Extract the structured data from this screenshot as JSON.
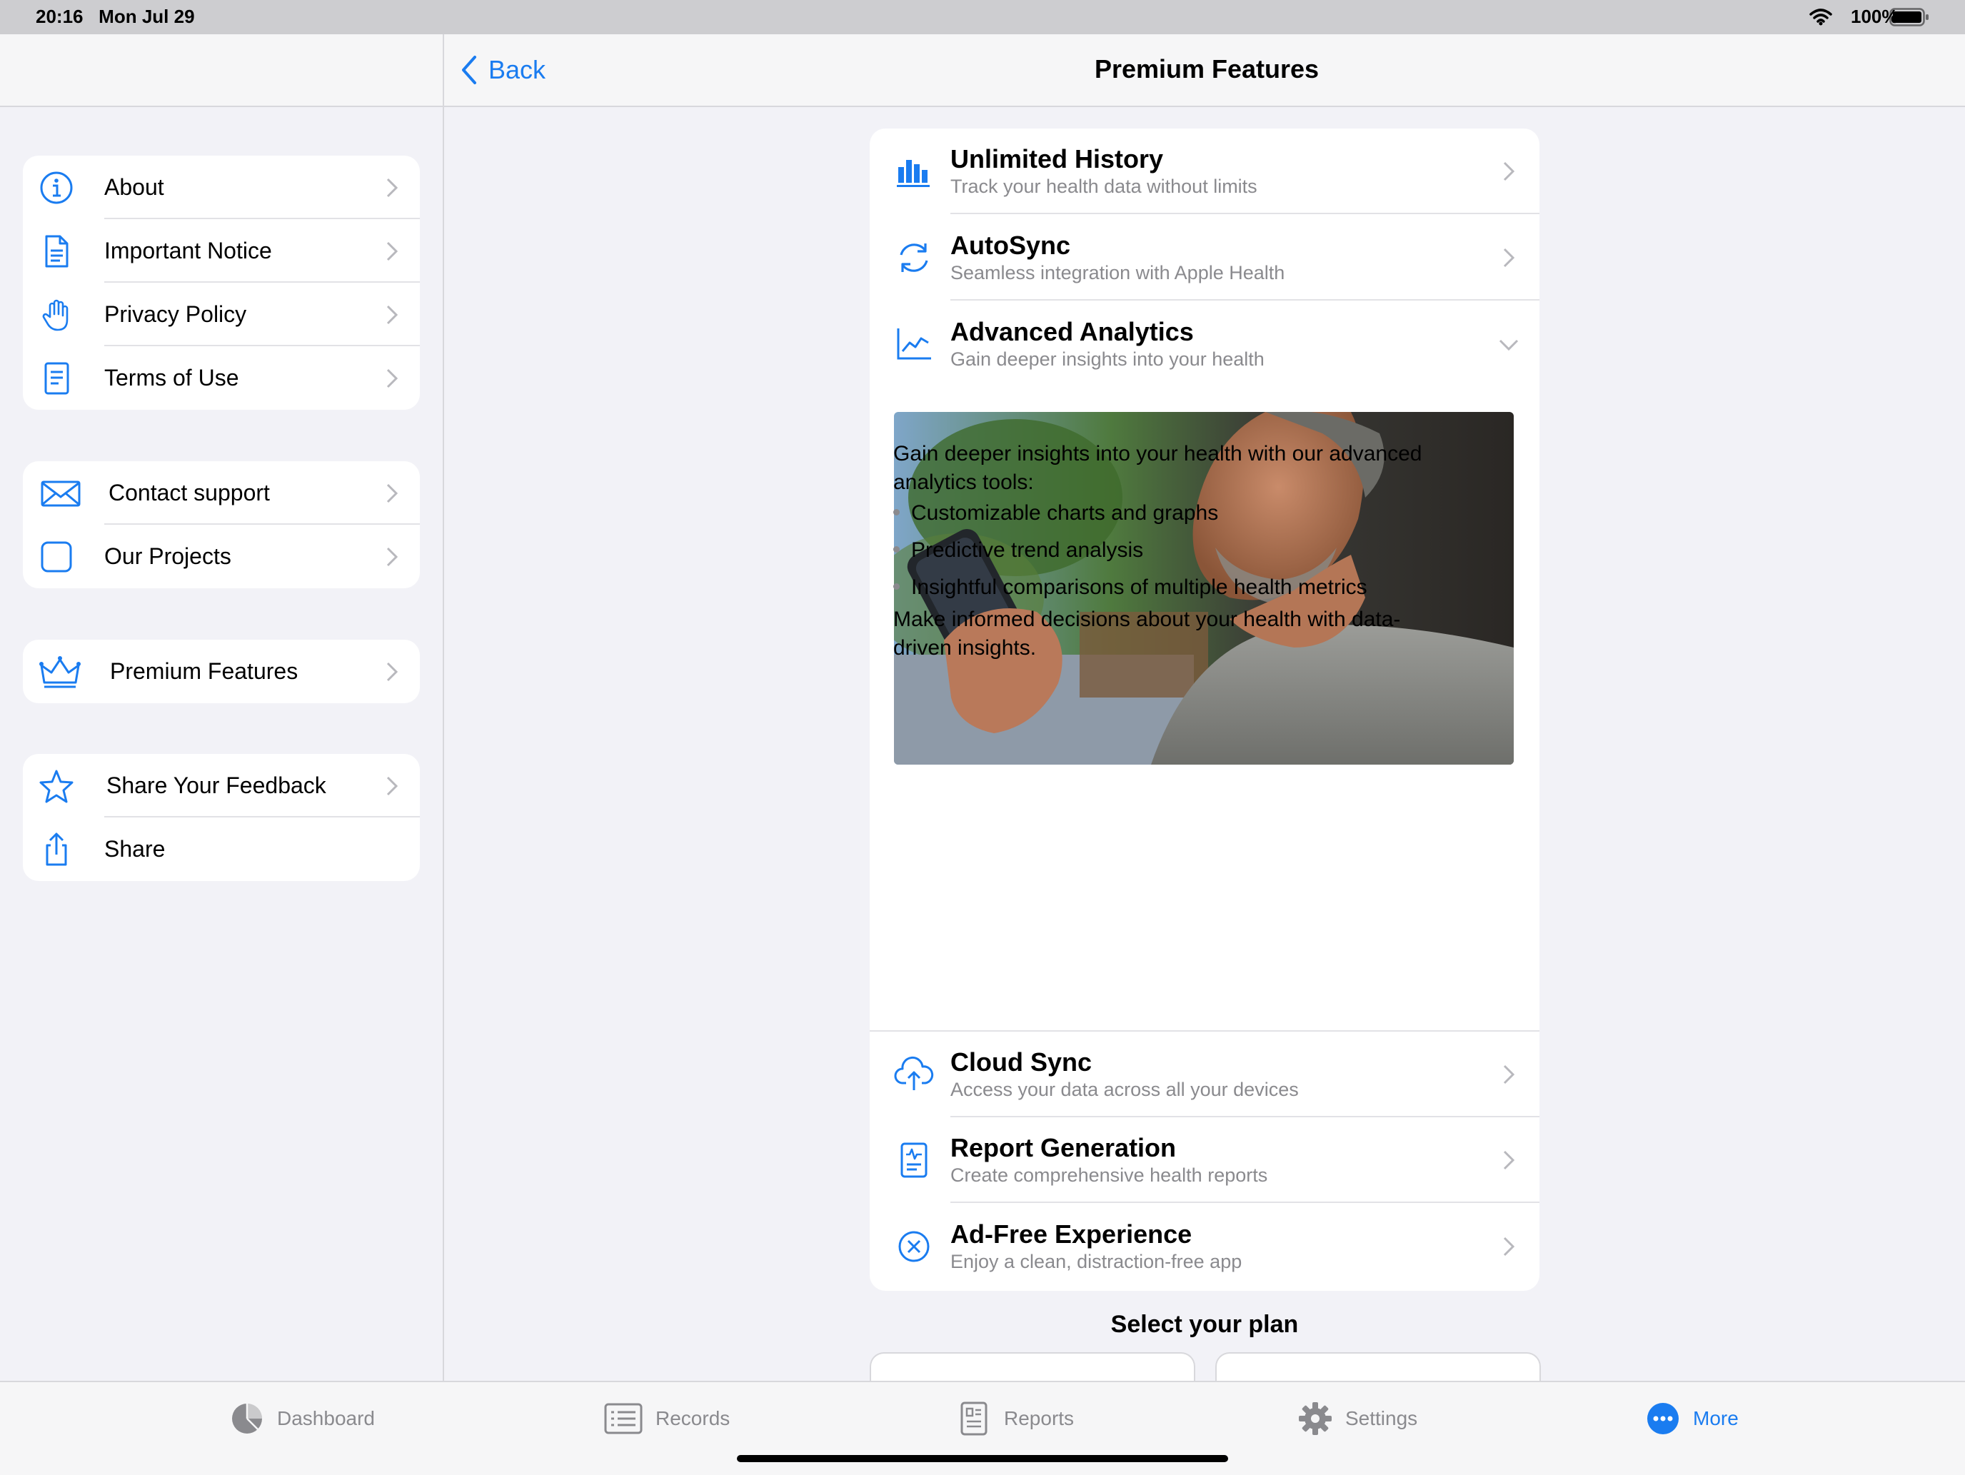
{
  "status_bar": {
    "time": "20:16",
    "date": "Mon Jul 29",
    "battery": "100%"
  },
  "sidebar": {
    "groups": [
      {
        "items": [
          {
            "label": "About",
            "icon": "info-circle-icon"
          },
          {
            "label": "Important Notice",
            "icon": "document-icon"
          },
          {
            "label": "Privacy Policy",
            "icon": "hand-icon"
          },
          {
            "label": "Terms of Use",
            "icon": "list-document-icon"
          }
        ]
      },
      {
        "items": [
          {
            "label": "Contact support",
            "icon": "envelope-icon"
          },
          {
            "label": "Our Projects",
            "icon": "square-icon"
          }
        ]
      },
      {
        "items": [
          {
            "label": "Premium Features",
            "icon": "crown-icon"
          }
        ]
      },
      {
        "items": [
          {
            "label": "Share Your Feedback",
            "icon": "star-icon"
          },
          {
            "label": "Share",
            "icon": "share-icon"
          }
        ]
      }
    ]
  },
  "header": {
    "back_label": "Back",
    "title": "Premium Features"
  },
  "features": [
    {
      "title": "Unlimited History",
      "subtitle": "Track your health data without limits",
      "icon": "bar-chart-icon"
    },
    {
      "title": "AutoSync",
      "subtitle": "Seamless integration with Apple Health",
      "icon": "sync-icon"
    },
    {
      "title": "Advanced Analytics",
      "subtitle": "Gain deeper insights into your health",
      "icon": "line-chart-icon",
      "expanded": true
    },
    {
      "title": "Cloud Sync",
      "subtitle": "Access your data across all your devices",
      "icon": "cloud-upload-icon"
    },
    {
      "title": "Report Generation",
      "subtitle": "Create comprehensive health reports",
      "icon": "report-icon"
    },
    {
      "title": "Ad-Free Experience",
      "subtitle": "Enjoy a clean, distraction-free app",
      "icon": "x-circle-icon"
    }
  ],
  "analytics_detail": {
    "intro": "Gain deeper insights into your health with our advanced analytics tools:",
    "bullets": [
      "Customizable charts and graphs",
      "Predictive trend analysis",
      "Insightful comparisons of multiple health metrics"
    ],
    "outro": "Make informed decisions about your health with data-driven insights."
  },
  "plan": {
    "title": "Select your plan"
  },
  "tabbar": {
    "tabs": [
      {
        "label": "Dashboard",
        "icon": "pie-chart-icon"
      },
      {
        "label": "Records",
        "icon": "list-icon"
      },
      {
        "label": "Reports",
        "icon": "report-doc-icon"
      },
      {
        "label": "Settings",
        "icon": "gear-icon"
      },
      {
        "label": "More",
        "icon": "more-icon",
        "active": true
      }
    ]
  },
  "colors": {
    "accent": "#1a7cf0",
    "background": "#f2f2f7",
    "secondary_text": "#8a8a8e"
  }
}
